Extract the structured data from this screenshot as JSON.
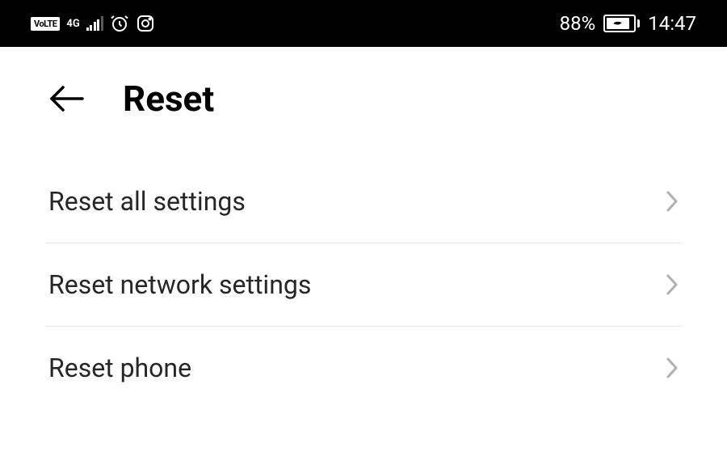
{
  "status_bar": {
    "volte_label": "VoLTE",
    "network_label": "4G",
    "battery_percent": "88%",
    "time": "14:47"
  },
  "header": {
    "title": "Reset"
  },
  "items": [
    {
      "label": "Reset all settings"
    },
    {
      "label": "Reset network settings"
    },
    {
      "label": "Reset phone"
    }
  ]
}
